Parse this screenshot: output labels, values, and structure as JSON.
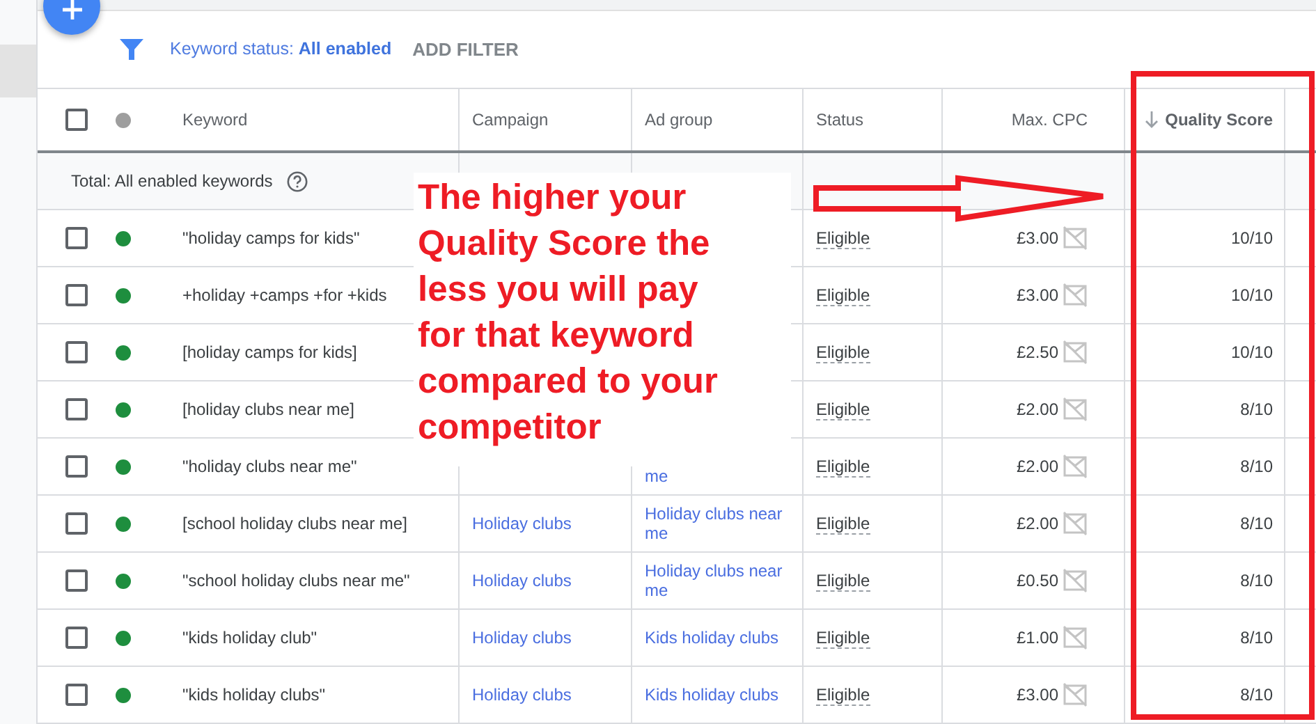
{
  "filter_bar": {
    "filter": "Keyword status: **All enabled**",
    "add_filter": "ADD FILTER"
  },
  "table": {
    "select_all_checked": false,
    "columns": [
      {
        "label": "Keyword",
        "sorted": false
      },
      {
        "label": "Campaign",
        "sorted": false
      },
      {
        "label": "Ad group",
        "sorted": false
      },
      {
        "label": "Status",
        "sorted": false
      },
      {
        "label": "Max. CPC",
        "sorted": false
      },
      {
        "label": "Quality Score",
        "sorted": true
      }
    ],
    "total": "Total: All enabled keywords",
    "rows": [
      {
        "checked": false,
        "keyword": "\"holiday camps for kids\"",
        "status": "Eligible",
        "max_cpc": "£3.00",
        "quality_score": "10/10"
      },
      {
        "checked": false,
        "keyword": "+holiday +camps +for +kids",
        "status": "Eligible",
        "max_cpc": "£3.00",
        "quality_score": "10/10"
      },
      {
        "checked": false,
        "keyword": "[holiday camps for kids]",
        "status": "Eligible",
        "max_cpc": "£2.50",
        "quality_score": "10/10"
      },
      {
        "checked": false,
        "keyword": "[holiday clubs near me]",
        "status": "Eligible",
        "max_cpc": "£2.00",
        "quality_score": "8/10"
      },
      {
        "checked": false,
        "keyword": "\"holiday clubs near me\"",
        "ad_group": "me",
        "status": "Eligible",
        "max_cpc": "£2.00",
        "quality_score": "8/10"
      },
      {
        "checked": false,
        "keyword": "[school holiday clubs near me]",
        "campaign": "Holiday clubs",
        "ad_group": "Holiday clubs near me",
        "status": "Eligible",
        "max_cpc": "£2.00",
        "quality_score": "8/10"
      },
      {
        "checked": false,
        "keyword": "\"school holiday clubs near me\"",
        "campaign": "Holiday clubs",
        "ad_group": "Holiday clubs near me",
        "status": "Eligible",
        "max_cpc": "£0.50",
        "quality_score": "8/10"
      },
      {
        "checked": false,
        "keyword": "\"kids holiday club\"",
        "campaign": "Holiday clubs",
        "ad_group": "Kids holiday clubs",
        "status": "Eligible",
        "max_cpc": "£1.00",
        "quality_score": "8/10"
      },
      {
        "checked": false,
        "keyword": "\"kids holiday clubs\"",
        "campaign": "Holiday clubs",
        "ad_group": "Kids holiday clubs",
        "status": "Eligible",
        "max_cpc": "£3.00",
        "quality_score": "8/10"
      }
    ]
  },
  "annotation": {
    "text": "The higher your Quality Score the less you will pay for that keyword compared to your competitor"
  }
}
